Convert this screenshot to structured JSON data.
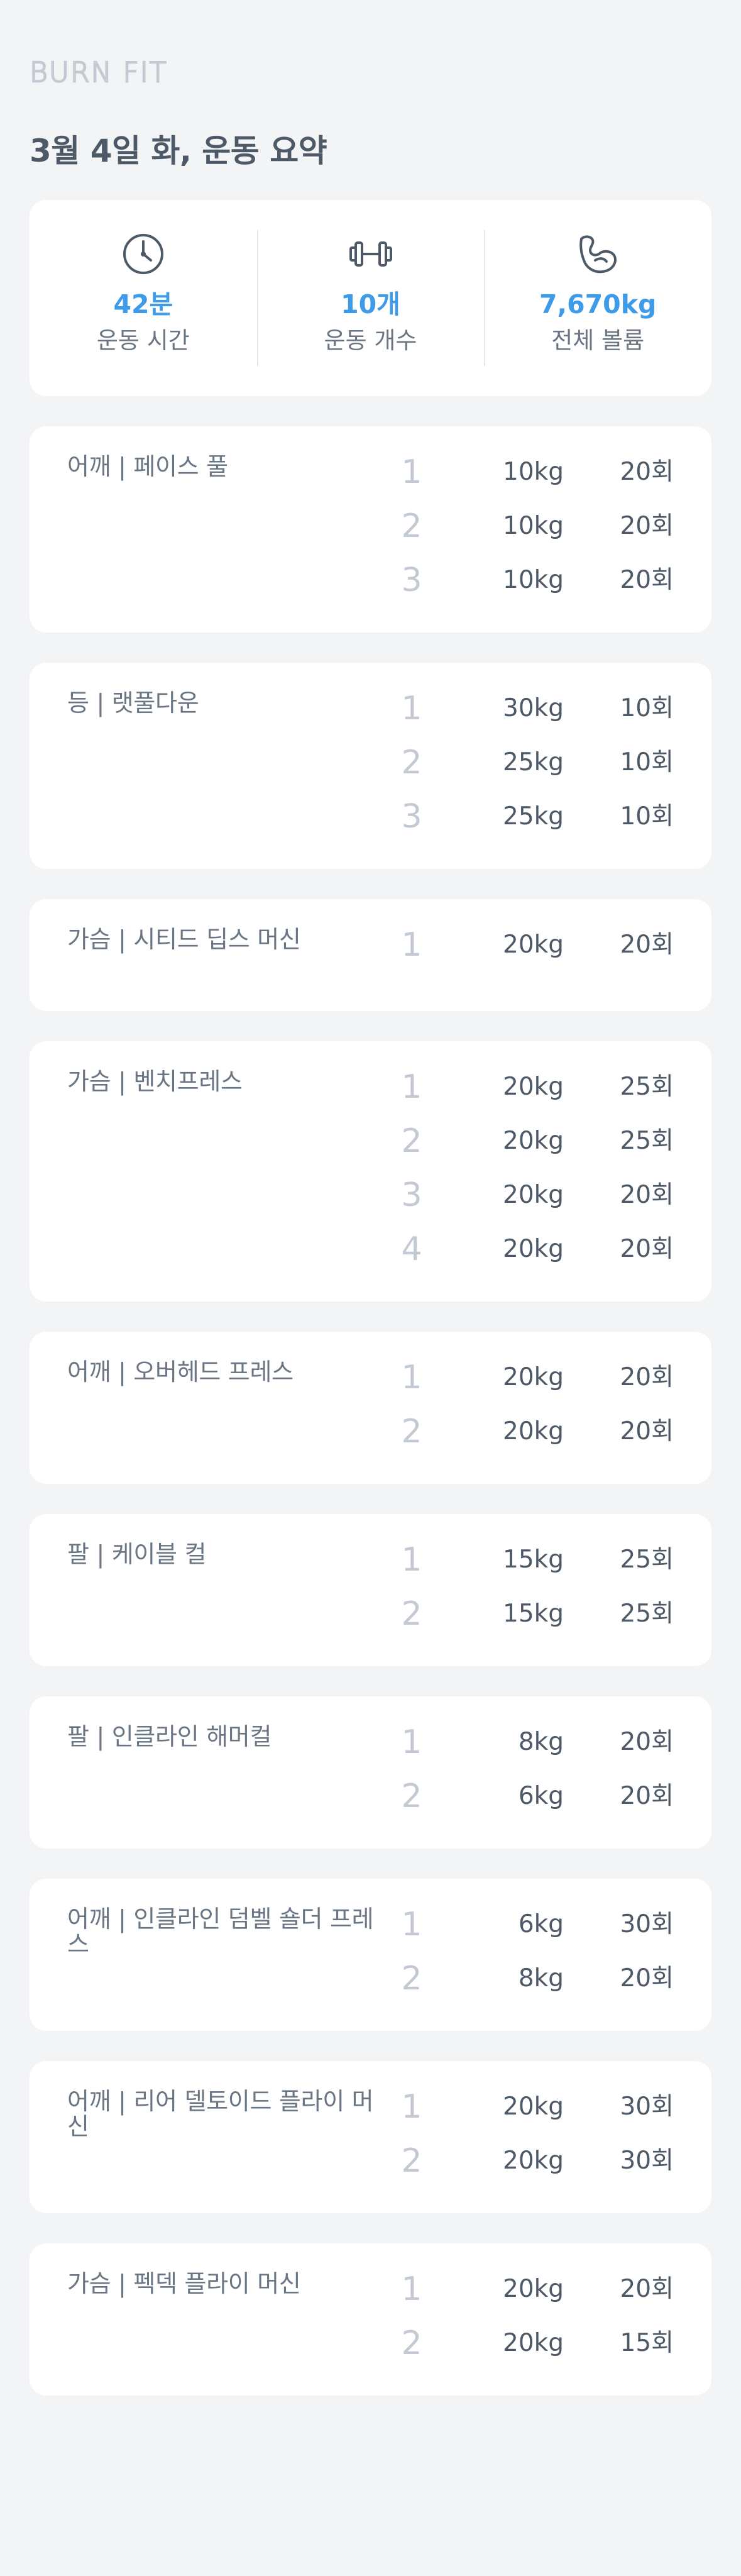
{
  "brand": {
    "logo_text": "BURN FIT"
  },
  "header": {
    "title": "3월 4일 화, 운동 요약"
  },
  "summary": [
    {
      "icon": "clock-icon",
      "value": "42분",
      "label": "운동 시간"
    },
    {
      "icon": "dumbbell-icon",
      "value": "10개",
      "label": "운동 개수"
    },
    {
      "icon": "muscle-arm-icon",
      "value": "7,670kg",
      "label": "전체 볼륨"
    }
  ],
  "colors": {
    "accent": "#3d9be9",
    "background": "#f2f4f6",
    "card": "#ffffff",
    "muted": "#c3cad3"
  },
  "exercises": [
    {
      "name": "어깨 | 페이스 풀",
      "sets": [
        {
          "num": "1",
          "weight": "10kg",
          "reps": "20회"
        },
        {
          "num": "2",
          "weight": "10kg",
          "reps": "20회"
        },
        {
          "num": "3",
          "weight": "10kg",
          "reps": "20회"
        }
      ]
    },
    {
      "name": "등 | 랫풀다운",
      "sets": [
        {
          "num": "1",
          "weight": "30kg",
          "reps": "10회"
        },
        {
          "num": "2",
          "weight": "25kg",
          "reps": "10회"
        },
        {
          "num": "3",
          "weight": "25kg",
          "reps": "10회"
        }
      ]
    },
    {
      "name": "가슴 | 시티드 딥스 머신",
      "sets": [
        {
          "num": "1",
          "weight": "20kg",
          "reps": "20회"
        }
      ]
    },
    {
      "name": "가슴 | 벤치프레스",
      "sets": [
        {
          "num": "1",
          "weight": "20kg",
          "reps": "25회"
        },
        {
          "num": "2",
          "weight": "20kg",
          "reps": "25회"
        },
        {
          "num": "3",
          "weight": "20kg",
          "reps": "20회"
        },
        {
          "num": "4",
          "weight": "20kg",
          "reps": "20회"
        }
      ]
    },
    {
      "name": "어깨 | 오버헤드 프레스",
      "sets": [
        {
          "num": "1",
          "weight": "20kg",
          "reps": "20회"
        },
        {
          "num": "2",
          "weight": "20kg",
          "reps": "20회"
        }
      ]
    },
    {
      "name": "팔 | 케이블 컬",
      "sets": [
        {
          "num": "1",
          "weight": "15kg",
          "reps": "25회"
        },
        {
          "num": "2",
          "weight": "15kg",
          "reps": "25회"
        }
      ]
    },
    {
      "name": "팔 | 인클라인 해머컬",
      "sets": [
        {
          "num": "1",
          "weight": "8kg",
          "reps": "20회"
        },
        {
          "num": "2",
          "weight": "6kg",
          "reps": "20회"
        }
      ]
    },
    {
      "name": "어깨 | 인클라인 덤벨 숄더 프레스",
      "sets": [
        {
          "num": "1",
          "weight": "6kg",
          "reps": "30회"
        },
        {
          "num": "2",
          "weight": "8kg",
          "reps": "20회"
        }
      ]
    },
    {
      "name": "어깨 | 리어 델토이드 플라이 머신",
      "sets": [
        {
          "num": "1",
          "weight": "20kg",
          "reps": "30회"
        },
        {
          "num": "2",
          "weight": "20kg",
          "reps": "30회"
        }
      ]
    },
    {
      "name": "가슴 | 펙덱 플라이 머신",
      "sets": [
        {
          "num": "1",
          "weight": "20kg",
          "reps": "20회"
        },
        {
          "num": "2",
          "weight": "20kg",
          "reps": "15회"
        }
      ]
    }
  ]
}
